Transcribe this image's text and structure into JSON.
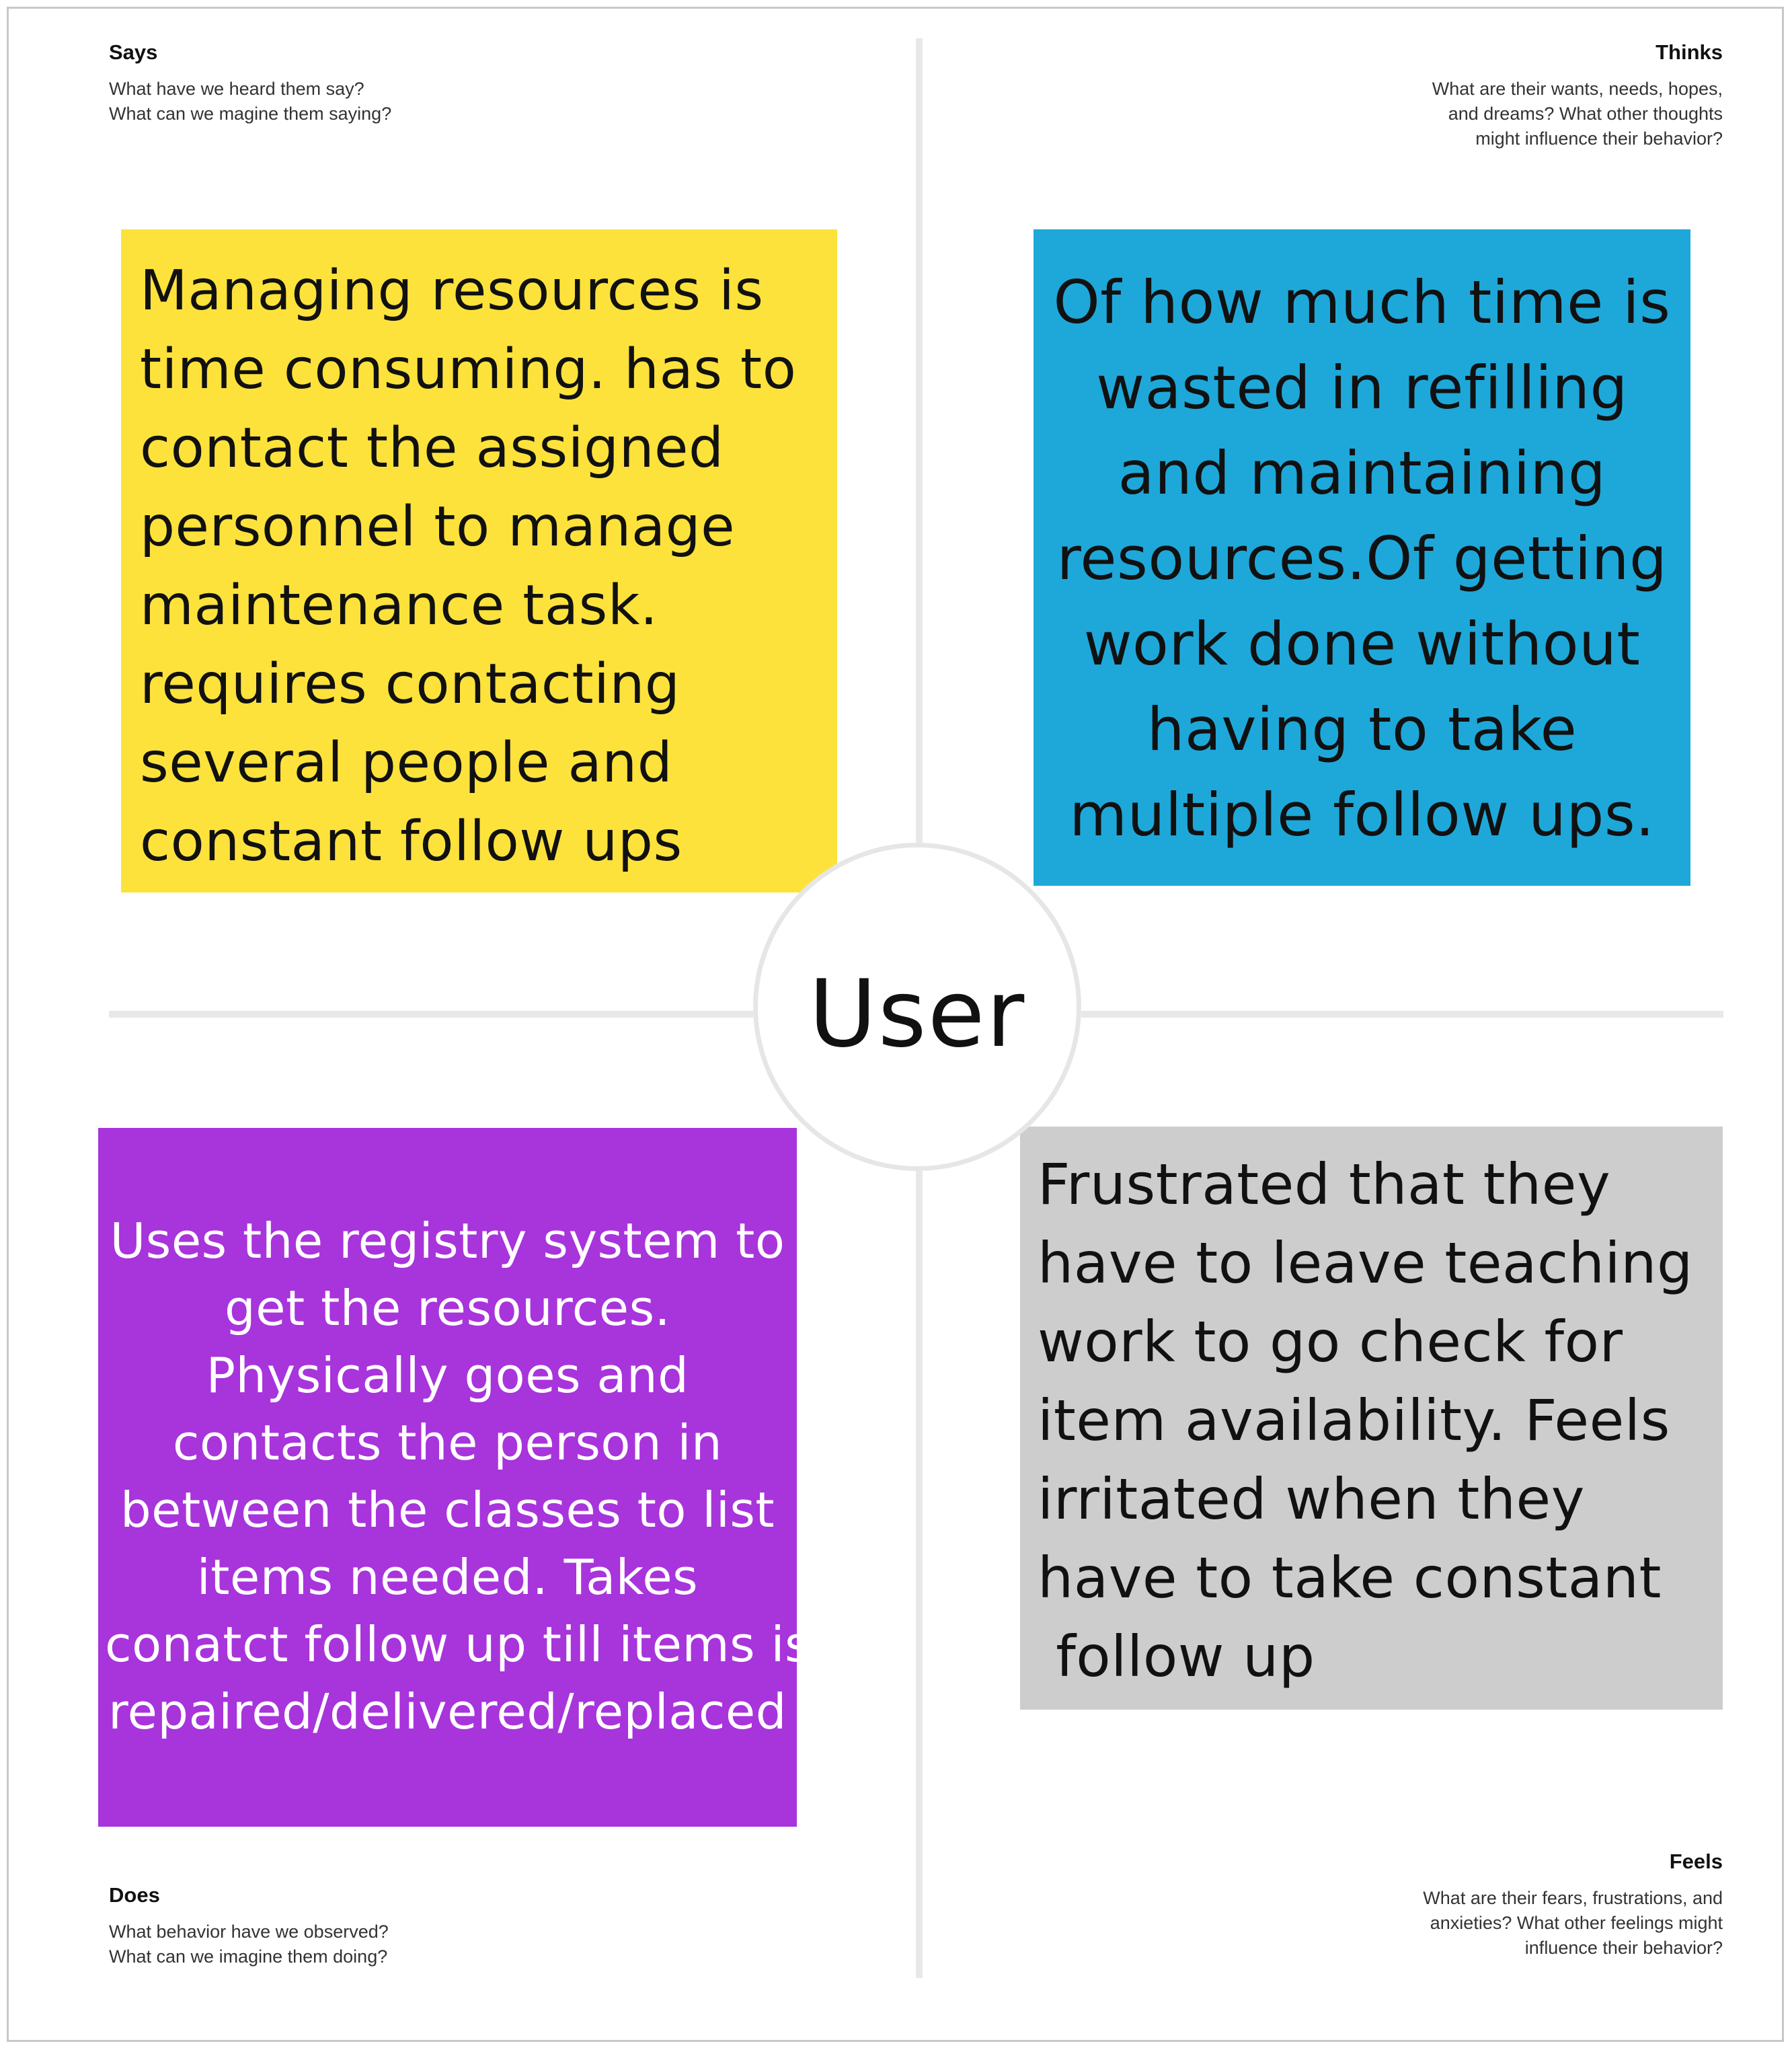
{
  "center": {
    "label": "User"
  },
  "quadrants": {
    "says": {
      "title": "Says",
      "hint": [
        "What have we heard them say?",
        "What can we magine them saying?"
      ]
    },
    "thinks": {
      "title": "Thinks",
      "hint": [
        "What are their wants, needs, hopes,",
        "and dreams? What other thoughts",
        "might influence their behavior?"
      ]
    },
    "does": {
      "title": "Does",
      "hint": [
        "What behavior have we observed?",
        "What can we imagine them doing?"
      ]
    },
    "feels": {
      "title": "Feels",
      "hint": [
        "What are their fears, frustrations, and",
        "anxieties? What other feelings might",
        "influence their behavior?"
      ]
    }
  },
  "notes": {
    "says": {
      "color": "#fde23c",
      "lines": [
        "Managing resources is",
        "time consuming. has to",
        "contact the assigned",
        "personnel to manage",
        "maintenance task.",
        "requires contacting",
        "several people and",
        "constant follow ups"
      ]
    },
    "thinks": {
      "color": "#1ea8d9",
      "lines": [
        "Of how much time is",
        "wasted in refilling",
        "and maintaining",
        "resources.Of getting",
        "work done without",
        "having to take",
        "multiple follow ups."
      ]
    },
    "does": {
      "color": "#a834dc",
      "lines": [
        "Uses the registry system to",
        "get the resources.",
        "Physically goes and",
        "contacts the person in",
        "between the classes to list",
        "items needed. Takes",
        "conatct follow up till items is",
        "repaired/delivered/replaced"
      ]
    },
    "feels": {
      "color": "#cdcdcd",
      "lines": [
        "Frustrated that they",
        "have to leave teaching",
        "work to go check for",
        "item availability. Feels",
        "irritated when they",
        "have to take constant",
        " follow up"
      ]
    }
  }
}
